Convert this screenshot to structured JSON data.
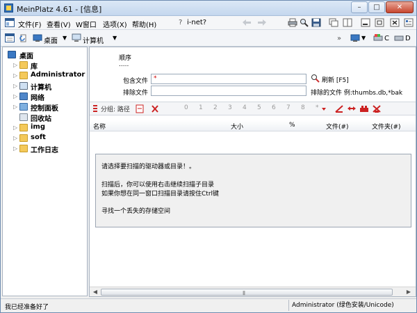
{
  "window": {
    "title": "MeinPlatz 4.61 - [信息]",
    "controls": {
      "minimize": "–",
      "maximize": "□",
      "close": "✕"
    }
  },
  "menubar": {
    "items": [
      "文件(F)",
      "查看(V)",
      "W窗口",
      "选项(X)",
      "帮助(H)"
    ],
    "help_text": "i-net?",
    "right_labels": {
      "drive_c": "C",
      "drive_d": "D"
    }
  },
  "toolbar": {
    "location_1": "桌面",
    "location_2": "计算机"
  },
  "tree": {
    "root": "桌面",
    "items": [
      {
        "label": "库",
        "icon": "library-icon"
      },
      {
        "label": "Administrator",
        "icon": "user-folder-icon"
      },
      {
        "label": "计算机",
        "icon": "computer-icon"
      },
      {
        "label": "网络",
        "icon": "network-icon"
      },
      {
        "label": "控制面板",
        "icon": "control-panel-icon"
      },
      {
        "label": "回收站",
        "icon": "recycle-bin-icon"
      },
      {
        "label": "img",
        "icon": "folder-icon"
      },
      {
        "label": "soft",
        "icon": "folder-icon"
      },
      {
        "label": "工作日志",
        "icon": "folder-icon"
      }
    ]
  },
  "search": {
    "order_label": "顺序",
    "order_value": ".....",
    "include_label": "包含文件",
    "include_value": "*",
    "exclude_label": "排除文件",
    "exclude_value": "",
    "refresh_label": "刷新 [F5]",
    "exclude_hint": "排除的文件 例:thumbs.db,*bak"
  },
  "toolbar3": {
    "group_label": "分组: 路径",
    "levels": [
      "0",
      "1",
      "2",
      "3",
      "4",
      "5",
      "6",
      "7",
      "8",
      "*"
    ]
  },
  "columns": [
    "名称",
    "大小",
    "%",
    "文件(#)",
    "文件夹(#)"
  ],
  "message": {
    "line1": "请选择要扫描的驱动器或目录！。",
    "line2": "扫描后，你可以使用右击继续扫描子目录",
    "line3": "如果你想在同一窗口扫描目录请按住Ctrl键",
    "line4": "寻找一个丢失的存储空间"
  },
  "status": {
    "left": "我已经准备好了",
    "right": "Administrator (绿色安装/Unicode)"
  }
}
